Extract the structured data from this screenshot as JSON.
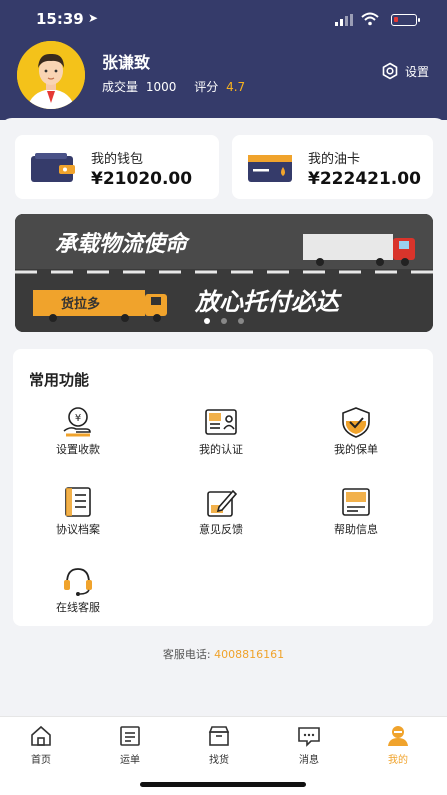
{
  "status_bar": {
    "time": "15:39",
    "location_glyph": "➤"
  },
  "profile": {
    "name": "张谦致",
    "volume_label": "成交量",
    "volume_value": "1000",
    "rating_label": "评分",
    "rating_value": "4.7",
    "settings_label": "设置"
  },
  "wallet": {
    "label": "我的钱包",
    "amount": "¥21020.00",
    "icon": "wallet-icon"
  },
  "oil_card": {
    "label": "我的油卡",
    "amount": "¥222421.00",
    "icon": "oil-card-icon"
  },
  "banner": {
    "headline_top": "承载物流使命",
    "brand_tag": "货拉多",
    "headline_bottom": "放心托付必达",
    "current_slide": 1,
    "slide_count": 3
  },
  "functions": {
    "title": "常用功能",
    "items": [
      {
        "label": "设置收款",
        "icon": "payment-hand-icon"
      },
      {
        "label": "我的认证",
        "icon": "id-card-icon"
      },
      {
        "label": "我的保单",
        "icon": "shield-check-icon"
      },
      {
        "label": "协议档案",
        "icon": "document-icon"
      },
      {
        "label": "意见反馈",
        "icon": "edit-icon"
      },
      {
        "label": "帮助信息",
        "icon": "help-book-icon"
      },
      {
        "label": "在线客服",
        "icon": "headset-icon"
      }
    ]
  },
  "service": {
    "label": "客服电话:",
    "phone": "4008816161"
  },
  "tabbar": {
    "items": [
      {
        "label": "首页",
        "icon": "home-icon"
      },
      {
        "label": "运单",
        "icon": "waybill-icon"
      },
      {
        "label": "找货",
        "icon": "box-icon"
      },
      {
        "label": "消息",
        "icon": "message-icon"
      },
      {
        "label": "我的",
        "icon": "profile-icon"
      }
    ],
    "active_index": 4
  },
  "colors": {
    "header": "#353b6a",
    "accent": "#f0a32c",
    "background": "#f2f3f6"
  }
}
